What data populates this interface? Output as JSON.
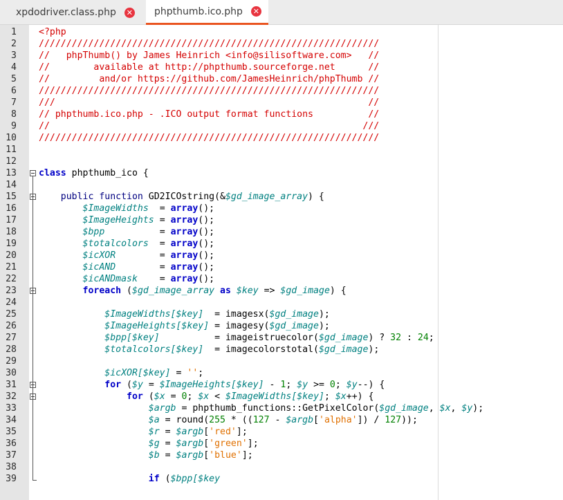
{
  "tabs": [
    {
      "label": "xpdodriver.class.php",
      "active": false
    },
    {
      "label": "phpthumb.ico.php",
      "active": true
    }
  ],
  "colors": {
    "comment": "#d40000",
    "keyword": "#0000c8",
    "variable": "#008080",
    "number": "#008000",
    "string": "#e07000",
    "accent": "#e95420"
  },
  "lines": [
    {
      "n": "1",
      "code": [
        [
          "<?php",
          "c-red"
        ]
      ]
    },
    {
      "n": "2",
      "code": [
        [
          "//////////////////////////////////////////////////////////////",
          "c-red"
        ]
      ]
    },
    {
      "n": "3",
      "code": [
        [
          "//   phpThumb() by James Heinrich <info@silisoftware.com>   //",
          "c-red"
        ]
      ]
    },
    {
      "n": "4",
      "code": [
        [
          "//        available at http://phpthumb.sourceforge.net      //",
          "c-red"
        ]
      ]
    },
    {
      "n": "5",
      "code": [
        [
          "//         and/or https://github.com/JamesHeinrich/phpThumb //",
          "c-red"
        ]
      ]
    },
    {
      "n": "6",
      "code": [
        [
          "//////////////////////////////////////////////////////////////",
          "c-red"
        ]
      ]
    },
    {
      "n": "7",
      "code": [
        [
          "///                                                         //",
          "c-red"
        ]
      ]
    },
    {
      "n": "8",
      "code": [
        [
          "// phpthumb.ico.php - .ICO output format functions          //",
          "c-red"
        ]
      ]
    },
    {
      "n": "9",
      "code": [
        [
          "//                                                         ///",
          "c-red"
        ]
      ]
    },
    {
      "n": "10",
      "code": [
        [
          "//////////////////////////////////////////////////////////////",
          "c-red"
        ]
      ]
    },
    {
      "n": "11",
      "code": []
    },
    {
      "n": "12",
      "code": []
    },
    {
      "n": "13",
      "code": [
        [
          "class",
          "c-blue"
        ],
        [
          " phpthumb_ico {",
          ""
        ]
      ]
    },
    {
      "n": "14",
      "code": []
    },
    {
      "n": "15",
      "code": [
        [
          "    ",
          ""
        ],
        [
          "public function",
          "c-navy"
        ],
        [
          " GD2ICOstring(&",
          ""
        ],
        [
          "$gd_image_array",
          "c-var"
        ],
        [
          ") {",
          ""
        ]
      ]
    },
    {
      "n": "16",
      "code": [
        [
          "        ",
          ""
        ],
        [
          "$ImageWidths",
          "c-var"
        ],
        [
          "  = ",
          ""
        ],
        [
          "array",
          "c-blue"
        ],
        [
          "();",
          ""
        ]
      ]
    },
    {
      "n": "17",
      "code": [
        [
          "        ",
          ""
        ],
        [
          "$ImageHeights",
          "c-var"
        ],
        [
          " = ",
          ""
        ],
        [
          "array",
          "c-blue"
        ],
        [
          "();",
          ""
        ]
      ]
    },
    {
      "n": "18",
      "code": [
        [
          "        ",
          ""
        ],
        [
          "$bpp",
          "c-var"
        ],
        [
          "          = ",
          ""
        ],
        [
          "array",
          "c-blue"
        ],
        [
          "();",
          ""
        ]
      ]
    },
    {
      "n": "19",
      "code": [
        [
          "        ",
          ""
        ],
        [
          "$totalcolors",
          "c-var"
        ],
        [
          "  = ",
          ""
        ],
        [
          "array",
          "c-blue"
        ],
        [
          "();",
          ""
        ]
      ]
    },
    {
      "n": "20",
      "code": [
        [
          "        ",
          ""
        ],
        [
          "$icXOR",
          "c-var"
        ],
        [
          "        = ",
          ""
        ],
        [
          "array",
          "c-blue"
        ],
        [
          "();",
          ""
        ]
      ]
    },
    {
      "n": "21",
      "code": [
        [
          "        ",
          ""
        ],
        [
          "$icAND",
          "c-var"
        ],
        [
          "        = ",
          ""
        ],
        [
          "array",
          "c-blue"
        ],
        [
          "();",
          ""
        ]
      ]
    },
    {
      "n": "22",
      "code": [
        [
          "        ",
          ""
        ],
        [
          "$icANDmask",
          "c-var"
        ],
        [
          "    = ",
          ""
        ],
        [
          "array",
          "c-blue"
        ],
        [
          "();",
          ""
        ]
      ]
    },
    {
      "n": "23",
      "code": [
        [
          "        ",
          ""
        ],
        [
          "foreach",
          "c-blue"
        ],
        [
          " (",
          ""
        ],
        [
          "$gd_image_array",
          "c-var"
        ],
        [
          " ",
          ""
        ],
        [
          "as",
          "c-blue"
        ],
        [
          " ",
          ""
        ],
        [
          "$key",
          "c-var"
        ],
        [
          " => ",
          ""
        ],
        [
          "$gd_image",
          "c-var"
        ],
        [
          ") {",
          ""
        ]
      ]
    },
    {
      "n": "24",
      "code": []
    },
    {
      "n": "25",
      "code": [
        [
          "            ",
          ""
        ],
        [
          "$ImageWidths[$key]",
          "c-var"
        ],
        [
          "  = imagesx(",
          ""
        ],
        [
          "$gd_image",
          "c-var"
        ],
        [
          ");",
          ""
        ]
      ]
    },
    {
      "n": "26",
      "code": [
        [
          "            ",
          ""
        ],
        [
          "$ImageHeights[$key]",
          "c-var"
        ],
        [
          " = imagesy(",
          ""
        ],
        [
          "$gd_image",
          "c-var"
        ],
        [
          ");",
          ""
        ]
      ]
    },
    {
      "n": "27",
      "code": [
        [
          "            ",
          ""
        ],
        [
          "$bpp[$key]",
          "c-var"
        ],
        [
          "          = imageistruecolor(",
          ""
        ],
        [
          "$gd_image",
          "c-var"
        ],
        [
          ") ? ",
          ""
        ],
        [
          "32",
          "c-green"
        ],
        [
          " : ",
          ""
        ],
        [
          "24",
          "c-green"
        ],
        [
          ";",
          ""
        ]
      ]
    },
    {
      "n": "28",
      "code": [
        [
          "            ",
          ""
        ],
        [
          "$totalcolors[$key]",
          "c-var"
        ],
        [
          "  = imagecolorstotal(",
          ""
        ],
        [
          "$gd_image",
          "c-var"
        ],
        [
          ");",
          ""
        ]
      ]
    },
    {
      "n": "29",
      "code": []
    },
    {
      "n": "30",
      "code": [
        [
          "            ",
          ""
        ],
        [
          "$icXOR[$key]",
          "c-var"
        ],
        [
          " = ",
          ""
        ],
        [
          "''",
          "c-str"
        ],
        [
          ";",
          ""
        ]
      ]
    },
    {
      "n": "31",
      "code": [
        [
          "            ",
          ""
        ],
        [
          "for",
          "c-blue"
        ],
        [
          " (",
          ""
        ],
        [
          "$y",
          "c-var"
        ],
        [
          " = ",
          ""
        ],
        [
          "$ImageHeights[$key]",
          "c-var"
        ],
        [
          " - ",
          ""
        ],
        [
          "1",
          "c-green"
        ],
        [
          "; ",
          ""
        ],
        [
          "$y",
          "c-var"
        ],
        [
          " >= ",
          ""
        ],
        [
          "0",
          "c-green"
        ],
        [
          "; ",
          ""
        ],
        [
          "$y",
          "c-var"
        ],
        [
          "--) {",
          ""
        ]
      ]
    },
    {
      "n": "32",
      "code": [
        [
          "                ",
          ""
        ],
        [
          "for",
          "c-blue"
        ],
        [
          " (",
          ""
        ],
        [
          "$x",
          "c-var"
        ],
        [
          " = ",
          ""
        ],
        [
          "0",
          "c-green"
        ],
        [
          "; ",
          ""
        ],
        [
          "$x",
          "c-var"
        ],
        [
          " < ",
          ""
        ],
        [
          "$ImageWidths[$key]",
          "c-var"
        ],
        [
          "; ",
          ""
        ],
        [
          "$x",
          "c-var"
        ],
        [
          "++) {",
          ""
        ]
      ]
    },
    {
      "n": "33",
      "code": [
        [
          "                    ",
          ""
        ],
        [
          "$argb",
          "c-var"
        ],
        [
          " = phpthumb_functions::GetPixelColor(",
          ""
        ],
        [
          "$gd_image",
          "c-var"
        ],
        [
          ", ",
          ""
        ],
        [
          "$x",
          "c-var"
        ],
        [
          ", ",
          ""
        ],
        [
          "$y",
          "c-var"
        ],
        [
          ");",
          ""
        ]
      ]
    },
    {
      "n": "34",
      "code": [
        [
          "                    ",
          ""
        ],
        [
          "$a",
          "c-var"
        ],
        [
          " = round(",
          ""
        ],
        [
          "255",
          "c-green"
        ],
        [
          " * ((",
          ""
        ],
        [
          "127",
          "c-green"
        ],
        [
          " - ",
          ""
        ],
        [
          "$argb",
          "c-var"
        ],
        [
          "[",
          ""
        ],
        [
          "'alpha'",
          "c-str"
        ],
        [
          "]) / ",
          ""
        ],
        [
          "127",
          "c-green"
        ],
        [
          "));",
          ""
        ]
      ]
    },
    {
      "n": "35",
      "code": [
        [
          "                    ",
          ""
        ],
        [
          "$r",
          "c-var"
        ],
        [
          " = ",
          ""
        ],
        [
          "$argb",
          "c-var"
        ],
        [
          "[",
          ""
        ],
        [
          "'red'",
          "c-str"
        ],
        [
          "];",
          ""
        ]
      ]
    },
    {
      "n": "36",
      "code": [
        [
          "                    ",
          ""
        ],
        [
          "$g",
          "c-var"
        ],
        [
          " = ",
          ""
        ],
        [
          "$argb",
          "c-var"
        ],
        [
          "[",
          ""
        ],
        [
          "'green'",
          "c-str"
        ],
        [
          "];",
          ""
        ]
      ]
    },
    {
      "n": "37",
      "code": [
        [
          "                    ",
          ""
        ],
        [
          "$b",
          "c-var"
        ],
        [
          " = ",
          ""
        ],
        [
          "$argb",
          "c-var"
        ],
        [
          "[",
          ""
        ],
        [
          "'blue'",
          "c-str"
        ],
        [
          "];",
          ""
        ]
      ]
    },
    {
      "n": "38",
      "code": []
    },
    {
      "n": "39",
      "code": [
        [
          "                    ",
          ""
        ],
        [
          "if",
          "c-blue"
        ],
        [
          " (",
          ""
        ],
        [
          "$bpp[$key",
          "c-var"
        ]
      ]
    }
  ],
  "folds": [
    "13",
    "15",
    "23",
    "31",
    "32"
  ]
}
